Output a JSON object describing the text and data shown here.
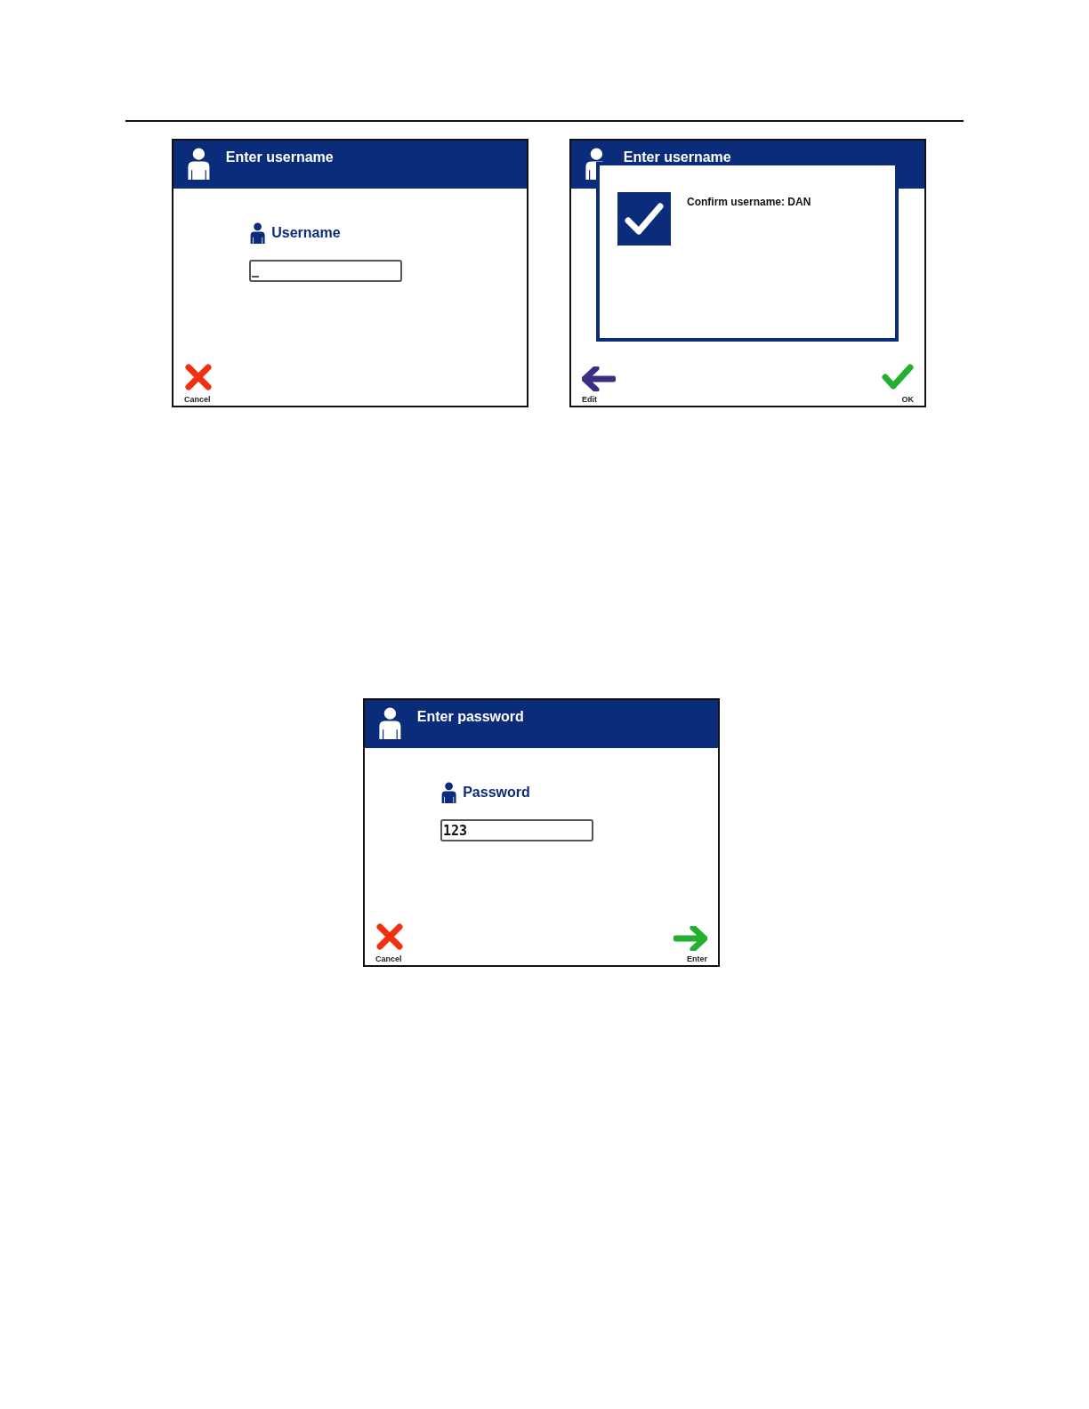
{
  "screens": [
    {
      "title": "Enter username",
      "field": {
        "label": "Username"
      },
      "buttons": [
        {
          "kind": "cancel",
          "label": "Cancel"
        }
      ]
    },
    {
      "title": "Enter username",
      "dialog": {
        "message": "Confirm username: DAN"
      },
      "buttons": [
        {
          "kind": "back",
          "label": "Edit"
        },
        {
          "kind": "ok",
          "label": "OK"
        }
      ]
    },
    {
      "title": "Enter password",
      "field": {
        "label": "Password",
        "value": "123"
      },
      "buttons": [
        {
          "kind": "cancel",
          "label": "Cancel"
        },
        {
          "kind": "enter",
          "label": "Enter"
        }
      ]
    }
  ]
}
